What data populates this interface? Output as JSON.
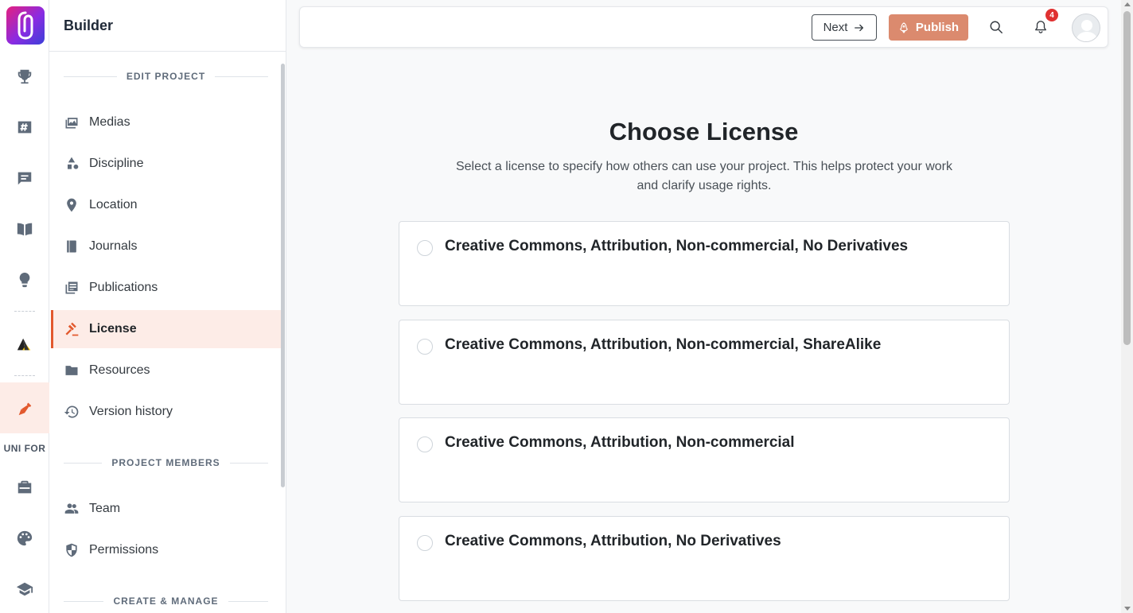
{
  "rail": {
    "items": [
      {
        "name": "trophy-icon"
      },
      {
        "name": "hashtag-board-icon"
      },
      {
        "name": "message-list-icon"
      },
      {
        "name": "open-book-icon"
      },
      {
        "name": "lightbulb-icon"
      },
      {
        "name": "peaks-logo-icon"
      },
      {
        "name": "pen-nib-icon",
        "active": true
      },
      {
        "name": "briefcase-icon"
      },
      {
        "name": "palette-icon"
      },
      {
        "name": "graduation-cap-icon"
      }
    ],
    "section_label": "UNI FOR"
  },
  "sidebar": {
    "title": "Builder",
    "sections": {
      "edit_project": "EDIT PROJECT",
      "project_members": "PROJECT MEMBERS",
      "create_manage": "CREATE & MANAGE"
    },
    "items": [
      {
        "label": "Medias",
        "icon": "images-icon"
      },
      {
        "label": "Discipline",
        "icon": "shapes-icon"
      },
      {
        "label": "Location",
        "icon": "map-pin-icon"
      },
      {
        "label": "Journals",
        "icon": "journal-icon"
      },
      {
        "label": "Publications",
        "icon": "publications-icon"
      },
      {
        "label": "License",
        "icon": "gavel-icon",
        "active": true
      },
      {
        "label": "Resources",
        "icon": "folder-icon"
      },
      {
        "label": "Version history",
        "icon": "history-icon"
      }
    ],
    "members": [
      {
        "label": "Team",
        "icon": "team-icon"
      },
      {
        "label": "Permissions",
        "icon": "shield-icon"
      }
    ]
  },
  "topbar": {
    "next_label": "Next",
    "publish_label": "Publish",
    "notification_count": "4"
  },
  "main": {
    "title": "Choose License",
    "subtitle": "Select a license to specify how others can use your project. This helps protect your work and clarify usage rights.",
    "licenses": [
      {
        "name": "Creative Commons, Attribution, Non-commercial, No Derivatives"
      },
      {
        "name": "Creative Commons, Attribution, Non-commercial, ShareAlike"
      },
      {
        "name": "Creative Commons, Attribution, Non-commercial"
      },
      {
        "name": "Creative Commons, Attribution, No Derivatives"
      }
    ]
  },
  "colors": {
    "accent": "#e2592e",
    "publish_bg": "#db8a6e",
    "active_bg": "#fdece7",
    "badge": "#e03131"
  }
}
